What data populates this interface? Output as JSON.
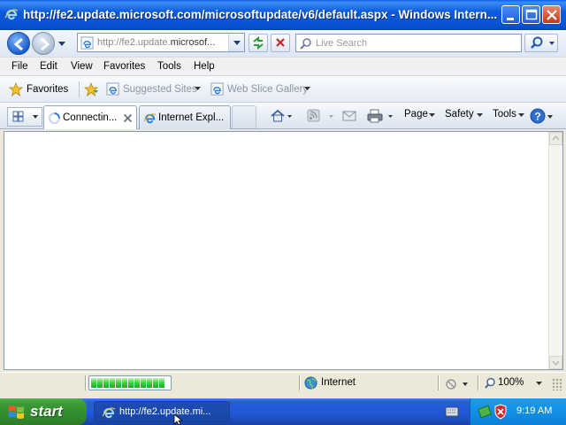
{
  "window": {
    "title": "http://fe2.update.microsoft.com/microsoftupdate/v6/default.aspx - Windows Intern..."
  },
  "address": {
    "url_prefix": "http://fe2.update.",
    "url_domain": "microsof..."
  },
  "search": {
    "placeholder": "Live Search"
  },
  "menu": {
    "file": "File",
    "edit": "Edit",
    "view": "View",
    "favorites": "Favorites",
    "tools": "Tools",
    "help": "Help"
  },
  "favorites_bar": {
    "favorites": "Favorites",
    "suggested_sites": "Suggested Sites",
    "web_slice_gallery": "Web Slice Gallery"
  },
  "tabs": [
    {
      "label": "Connectin...",
      "active": true
    },
    {
      "label": "Internet Expl...",
      "active": false
    }
  ],
  "command_bar": {
    "page": "Page",
    "safety": "Safety",
    "tools": "Tools"
  },
  "status": {
    "progress_fraction": 0.95,
    "zone": "Internet",
    "zoom": "100%"
  },
  "taskbar": {
    "start": "start",
    "task_label": "http://fe2.update.mi...",
    "clock": "9:19 AM"
  },
  "colors": {
    "titlebar": "#0752D3",
    "taskbar": "#2157D4",
    "start_button": "#3C9A37",
    "tray": "#1290E6"
  }
}
